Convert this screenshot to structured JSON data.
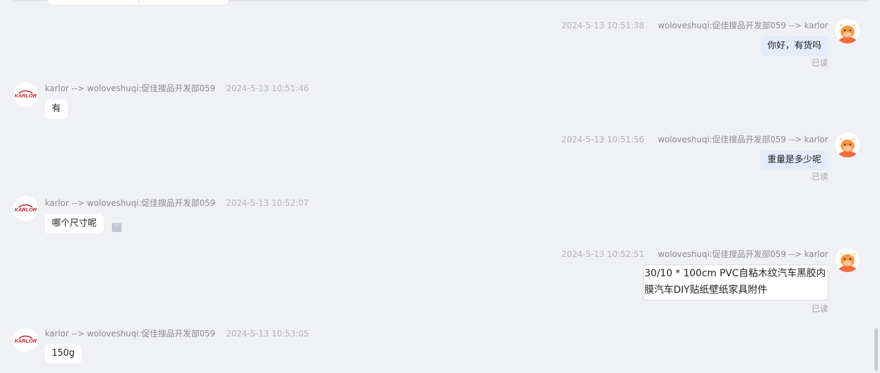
{
  "messages": [
    {
      "direction": "out",
      "time": "2024-5-13 10:51:38",
      "route": "woloveshuqi:促佳搜品开发部059 --> karlor",
      "text": "你好，有货吗",
      "status": "已读"
    },
    {
      "direction": "in",
      "route": "karlor --> woloveshuqi:促佳搜品开发部059",
      "time": "2024-5-13 10:51:46",
      "text": "有"
    },
    {
      "direction": "out",
      "time": "2024-5-13 10:51:56",
      "route": "woloveshuqi:促佳搜品开发部059 --> karlor",
      "text": "重量是多少呢",
      "status": "已读"
    },
    {
      "direction": "in",
      "route": "karlor --> woloveshuqi:促佳搜品开发部059",
      "time": "2024-5-13 10:52:07",
      "text": "哪个尺寸呢"
    },
    {
      "direction": "out",
      "time": "2024-5-13 10:52:51",
      "route": "woloveshuqi:促佳搜品开发部059 --> karlor",
      "text": "30/10 * 100cm PVC自粘木纹汽车黑胶内膜汽车DIY贴纸壁纸家具附件",
      "status": "已读"
    },
    {
      "direction": "in",
      "route": "karlor --> woloveshuqi:促佳搜品开发部059",
      "time": "2024-5-13 10:53:05",
      "text": "150g"
    }
  ],
  "avatars": {
    "seller_logo_text": "KARLOR",
    "buyer_icon": "cartoon-cow-icon"
  },
  "colors": {
    "background": "#f0f1f5",
    "outgoing_bubble": "#e3ebfc",
    "incoming_bubble": "#ffffff",
    "meta_text": "#8a8a8a",
    "logo_red": "#c8202a"
  }
}
